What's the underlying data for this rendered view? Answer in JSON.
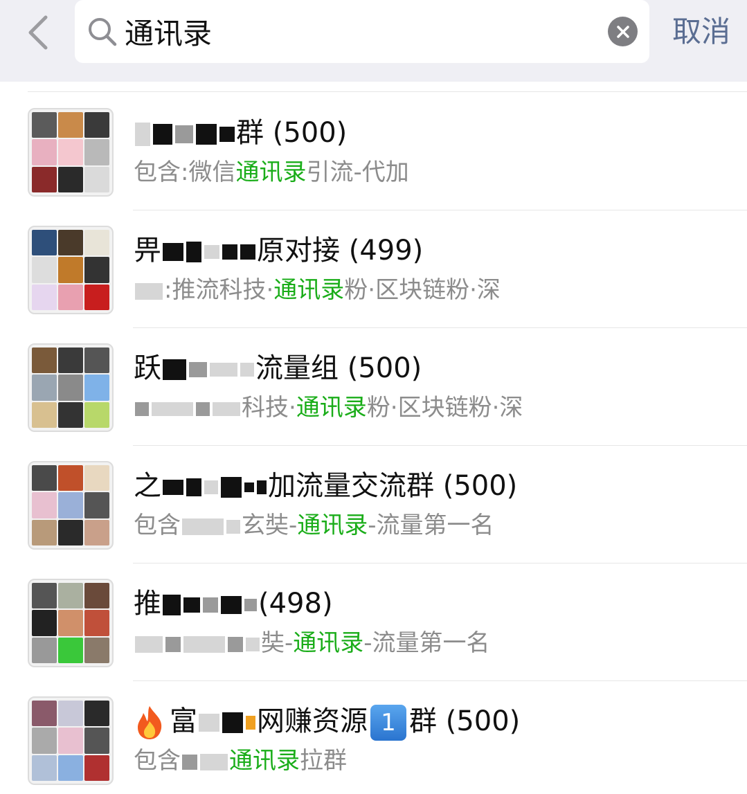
{
  "header": {
    "search_query": "通讯录",
    "cancel_label": "取消"
  },
  "colors": {
    "highlight": "#1aad19",
    "cancel": "#5a6d92",
    "header_bg": "#efeff4",
    "subtitle": "#8c8c8c"
  },
  "icons": [
    "back-chevron-icon",
    "search-icon",
    "clear-icon",
    "fire-icon",
    "keycap-one-icon"
  ],
  "results": [
    {
      "title_suffix": "群 (500)",
      "sub_prefix": "包含:微信",
      "sub_match": "通讯录",
      "sub_suffix": "引流-代加"
    },
    {
      "title_prefix": "畀",
      "title_suffix": "原对接 (499)",
      "sub_prefix": ":推流科技·",
      "sub_match": "通讯录",
      "sub_suffix": "粉·区块链粉·深"
    },
    {
      "title_prefix": "跃",
      "title_suffix": "流量组 (500)",
      "sub_prefix": "科技·",
      "sub_match": "通讯录",
      "sub_suffix": "粉·区块链粉·深"
    },
    {
      "title_prefix": "之",
      "title_suffix": "加流量交流群 (500)",
      "sub_prefix": "包含",
      "sub_mid": "玄奘-",
      "sub_match": "通讯录",
      "sub_suffix": "-流量第一名"
    },
    {
      "title_prefix": "推",
      "title_suffix": "(498)",
      "sub_mid": "奘-",
      "sub_match": "通讯录",
      "sub_suffix": "-流量第一名"
    },
    {
      "title_prefix": "富",
      "title_mid": "网赚资源",
      "badge": "1",
      "title_suffix": "群 (500)",
      "sub_prefix": "包含",
      "sub_match": "通讯录",
      "sub_suffix": "拉群"
    }
  ]
}
